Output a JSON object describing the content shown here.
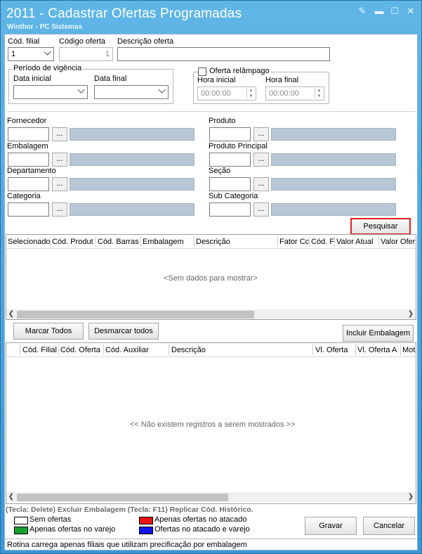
{
  "window": {
    "title": "2011 - Cadastrar Ofertas Programadas",
    "subtitle": "Winthor - PC Sistemas",
    "controls": [
      "edit-icon",
      "minimize-icon",
      "maximize-icon",
      "close-icon"
    ]
  },
  "form": {
    "filial": {
      "label": "Cód. filial",
      "value": "1"
    },
    "codigo_oferta": {
      "label": "Código oferta",
      "value": "1"
    },
    "descricao": {
      "label": "Descrição oferta",
      "value": ""
    },
    "periodo": {
      "title": "Período de vigência",
      "data_inicial": "Data inicial",
      "data_final": "Data final"
    },
    "relampago": {
      "label": "Oferta relâmpago",
      "checked": false,
      "hora_inicial": "Hora inicial",
      "hora_final": "Hora final",
      "hora_inicial_value": "00:00:00",
      "hora_final_value": "00:00:00"
    }
  },
  "filters": {
    "fornecedor": "Fornecedor",
    "embalagem": "Embalagem",
    "departamento": "Departamento",
    "categoria": "Categoria",
    "produto": "Produto",
    "produto_principal": "Produto Principal",
    "secao": "Seção",
    "sub_categoria": "Sub Categoria",
    "ellipsis": "...",
    "pesquisar": "Pesquisar"
  },
  "grid1": {
    "columns": [
      "Selecionado",
      "Cód. Produt",
      "Cód. Barras",
      "Embalagem",
      "Descrição",
      "Fator Cc",
      "Cód. F",
      "Valor Atual",
      "Valor Ofer"
    ],
    "empty": "<Sem dados para mostrar>"
  },
  "actions": {
    "marcar": "Marcar Todos",
    "desmarcar": "Desmarcar todos",
    "incluir": "Incluir Embalagem"
  },
  "grid2": {
    "columns": [
      "Cód. Filial",
      "Cód. Oferta",
      "Cód. Auxiliar",
      "Descrição",
      "Vl. Oferta",
      "Vl. Oferta A",
      "Motiv"
    ],
    "empty": "<< Não existem registros a serem mostrados >>"
  },
  "footer": {
    "hint": "(Tecla: Delete) Excluir Embalagem   (Tecla: F11) Replicar Cód. Histórico.",
    "legend": [
      {
        "label": "Sem ofertas",
        "color": "#ffffff"
      },
      {
        "label": "Apenas ofertas no varejo",
        "color": "#16a030"
      },
      {
        "label": "Apenas ofertas no atacado",
        "color": "#ee1111"
      },
      {
        "label": "Ofertas no atacado e varejo",
        "color": "#1414ee"
      }
    ],
    "gravar": "Gravar",
    "cancelar": "Cancelar",
    "status": "Rotina carrega apenas filiais que utilizam precificação por embalagem"
  }
}
